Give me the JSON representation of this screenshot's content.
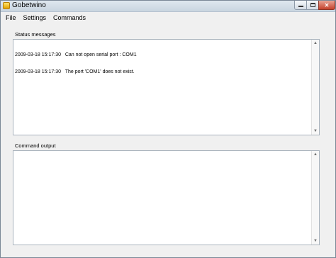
{
  "window": {
    "title": "Gobetwino"
  },
  "menu": {
    "items": [
      {
        "label": "File"
      },
      {
        "label": "Settings"
      },
      {
        "label": "Commands"
      }
    ]
  },
  "status": {
    "label": "Status messages",
    "lines": [
      "2009-03-18 15:17:30   Can not open serial port : COM1",
      "2009-03-18 15:17:30   The port 'COM1' does not exist."
    ]
  },
  "output": {
    "label": "Command output",
    "lines": []
  },
  "icons": {
    "app": "app-icon",
    "minimize": "minimize-icon",
    "maximize": "maximize-icon",
    "close": "close-icon",
    "scroll_up": "scroll-up-arrow-icon",
    "scroll_down": "scroll-down-arrow-icon"
  }
}
